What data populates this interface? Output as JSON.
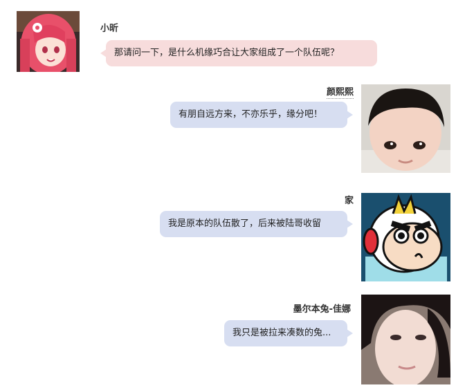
{
  "messages": [
    {
      "sender": "小昕",
      "text": "那请问一下，是什么机缘巧合让大家组成了一个队伍呢？",
      "avatar": "anime-girl-pink-hair-avatar"
    },
    {
      "sender": "颜熙熙",
      "text": "有朋自远方来，不亦乐乎，缘分吧！",
      "avatar": "baby-photo-avatar"
    },
    {
      "sender": "家",
      "text": "我是原本的队伍散了，后来被陆哥收留",
      "avatar": "cartoon-boy-helmet-avatar"
    },
    {
      "sender": "墨尔本兔-佳娜",
      "text": "我只是被拉来凑数的兔...",
      "avatar": "woman-selfie-avatar"
    }
  ],
  "colors": {
    "incoming_bubble": "#f7dcdc",
    "outgoing_bubble": "#d7def1"
  }
}
